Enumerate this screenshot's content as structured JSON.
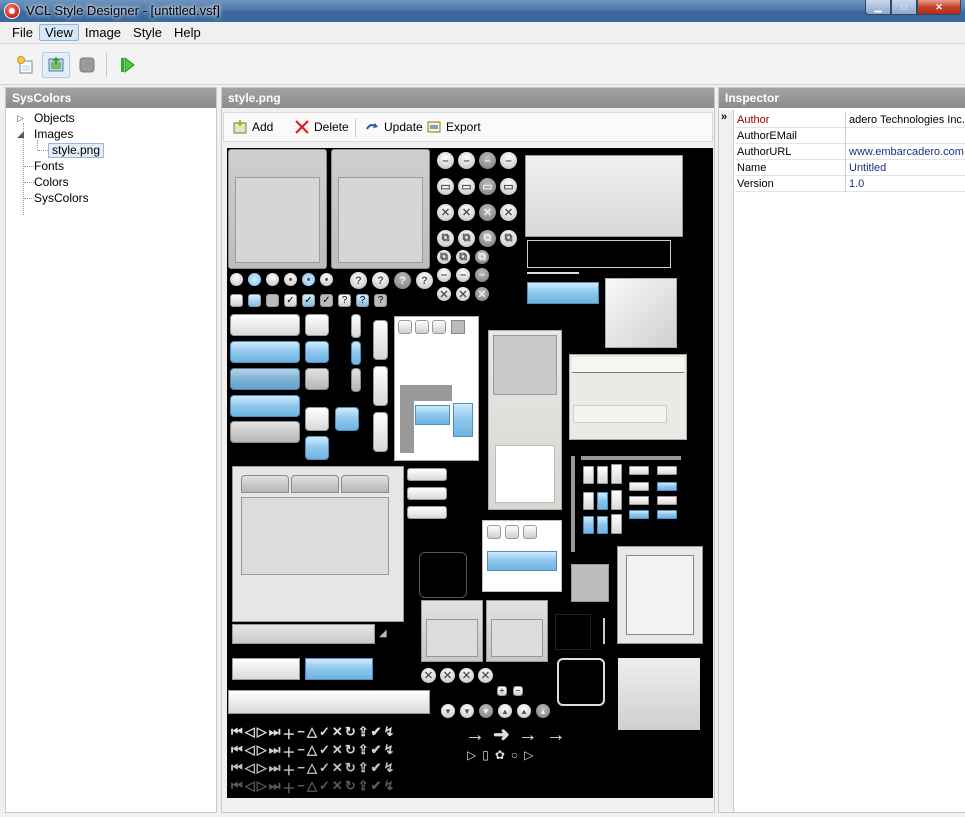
{
  "window": {
    "title": "VCL Style Designer - [untitled.vsf]"
  },
  "menu": {
    "file": "File",
    "view": "View",
    "image": "Image",
    "style": "Style",
    "help": "Help"
  },
  "left_panel": {
    "header": "SysColors",
    "tree": {
      "objects": "Objects",
      "images": "Images",
      "style_png": "style.png",
      "fonts": "Fonts",
      "colors": "Colors",
      "syscolors": "SysColors"
    }
  },
  "center_panel": {
    "header": "style.png",
    "toolbar": {
      "add": "Add",
      "delete": "Delete",
      "update": "Update",
      "export": "Export"
    }
  },
  "inspector": {
    "header": "Inspector",
    "rows": [
      {
        "key": "Author",
        "value": "adero Technologies Inc."
      },
      {
        "key": "AuthorEMail",
        "value": ""
      },
      {
        "key": "AuthorURL",
        "value": "www.embarcadero.com"
      },
      {
        "key": "Name",
        "value": "Untitled"
      },
      {
        "key": "Version",
        "value": "1.0"
      }
    ]
  },
  "colors": {
    "titlebar": "#4e78a8",
    "panel_header": "#999999",
    "canvas_bg": "#000000",
    "accent_blue": "#8cc6ec",
    "author_key": "#a00000",
    "value_blue": "#1f2f86"
  }
}
